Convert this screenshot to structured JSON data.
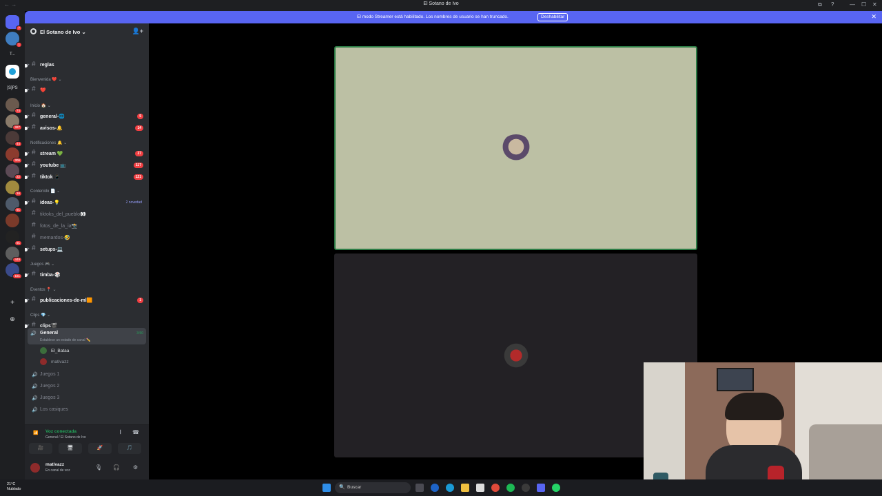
{
  "window": {
    "title": "El Sotano de Ivo",
    "back": "←",
    "forward": "→",
    "controls": [
      "⧉",
      "?",
      "—",
      "☐",
      "✕"
    ]
  },
  "banner": {
    "message": "El modo Streamer está habilitado. Los nombres de usuario se han truncado.",
    "button": "Deshabilitar",
    "close": "✕"
  },
  "servers": {
    "text_item": "T...",
    "text_item2": "[S]PS",
    "badges": [
      "7",
      "1",
      "74",
      "327",
      "44",
      "306",
      "22",
      "16",
      "91",
      "449",
      "181"
    ],
    "add_label": "+",
    "discover_label": "⊕"
  },
  "guild": {
    "name": "El Sotano de Ivo",
    "chevron": "⌄",
    "invite_icon": "👤+"
  },
  "channels": [
    {
      "type": "text",
      "label": "reglas",
      "unread": true
    },
    {
      "type": "category",
      "label": "Bienvenida ❤️ ⌄"
    },
    {
      "type": "text",
      "label": "❤️",
      "unread": true
    },
    {
      "type": "category",
      "label": "Inicio 🏠 ⌄"
    },
    {
      "type": "text",
      "label": "general-🌐",
      "unread": true,
      "count": "5"
    },
    {
      "type": "text",
      "label": "avisos-🔔",
      "unread": true,
      "count": "14"
    },
    {
      "type": "category",
      "label": "Notificaciones 🔔 ⌄"
    },
    {
      "type": "text",
      "label": "stream 💚",
      "unread": true,
      "count": "37"
    },
    {
      "type": "text",
      "label": "youtube 📺",
      "unread": true,
      "count": "117"
    },
    {
      "type": "text",
      "label": "tiktok 📱",
      "unread": true,
      "count": "121"
    },
    {
      "type": "category",
      "label": "Contenido 📄 ⌄"
    },
    {
      "type": "text",
      "label": "ideas-💡",
      "unread": true,
      "new": "2 novedad"
    },
    {
      "type": "text",
      "label": "tiktoks_del_pueblo👀",
      "unread": false
    },
    {
      "type": "text",
      "label": "fotos_de_la_ia📸",
      "unread": false
    },
    {
      "type": "text",
      "label": "memardos-🤣",
      "unread": false
    },
    {
      "type": "text",
      "label": "setups-💻",
      "unread": true
    },
    {
      "type": "category",
      "label": "Juegos 🎮 ⌄"
    },
    {
      "type": "text",
      "label": "timba-🎲",
      "unread": true
    },
    {
      "type": "category",
      "label": "Eventos 📍 ⌄"
    },
    {
      "type": "text",
      "label": "publicaciones-de-ml🟧",
      "unread": true,
      "count": "1"
    },
    {
      "type": "category",
      "label": "Clips 💎 ⌄"
    },
    {
      "type": "text",
      "label": "clips🎬",
      "unread": true
    },
    {
      "type": "category",
      "label": "Canales de voz ⌄"
    }
  ],
  "voice_active": {
    "label": "General",
    "status": "Establece un estado de canal ✏️",
    "time": "3:50",
    "users": [
      {
        "name": "El_Bataa",
        "color": "#dbdee1"
      },
      {
        "name": "mativazz",
        "color": "#949ba4"
      }
    ]
  },
  "voice_channels": [
    "Juegos 1",
    "Juegos 2",
    "Juegos 3",
    "Los casiques"
  ],
  "voice_panel": {
    "title": "Voz conectada",
    "subtitle": "General / El Sotano de Ivo",
    "signal_icon": "📶",
    "buttons": [
      "🎥",
      "🖥",
      "🚀",
      "🎵"
    ]
  },
  "user_panel": {
    "username": "mativazz",
    "status": "En canal de voz",
    "mic": "🎙",
    "headset": "🎧",
    "settings": "⚙"
  },
  "taskbar": {
    "temp": "21°C",
    "weather": "Nublado",
    "search": "Buscar",
    "search_icon": "🔍"
  },
  "colors": {
    "accent": "#5865f2",
    "speaking_border": "#2d7d46",
    "online": "#23a55a",
    "badge": "#f23f42"
  }
}
